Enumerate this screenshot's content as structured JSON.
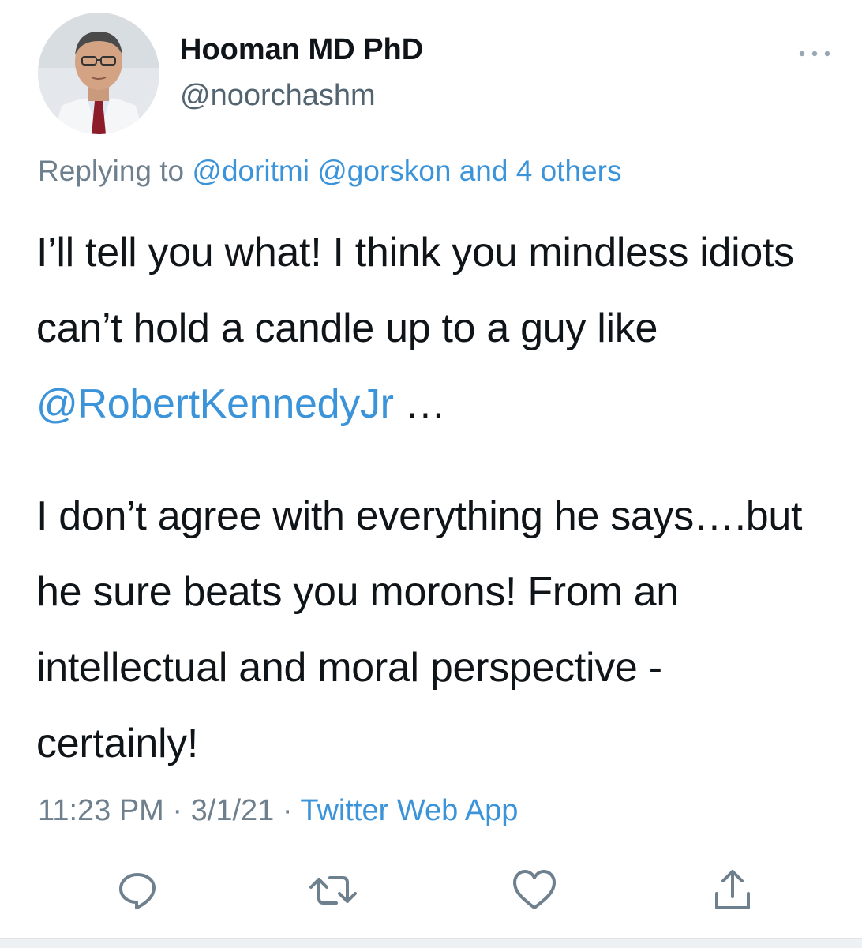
{
  "user": {
    "display_name": "Hooman MD PhD",
    "handle": "@noorchashm"
  },
  "reply": {
    "prefix": "Replying to ",
    "mention1": "@doritmi",
    "mention2": "@gorskon",
    "others": "and 4 others"
  },
  "tweet": {
    "p1_text": "I’ll tell you what! I think you mindless idiots can’t hold a candle up to a guy like ",
    "p1_mention": "@RobertKennedyJr",
    "p1_end": " …",
    "p2_text": "I don’t agree with everything he says….but he sure beats you morons! From an intellectual and moral perspective - certainly!"
  },
  "meta": {
    "time": "11:23 PM",
    "separator": " · ",
    "date": "3/1/21",
    "source": "Twitter Web App"
  },
  "icons": {
    "more": "more-horizontal-icon",
    "reply": "reply-bubble-icon",
    "retweet": "retweet-icon",
    "like": "heart-icon",
    "share": "share-icon"
  },
  "colors": {
    "link": "#3b94d9",
    "muted": "#6e7f8d",
    "text": "#0f1419"
  }
}
